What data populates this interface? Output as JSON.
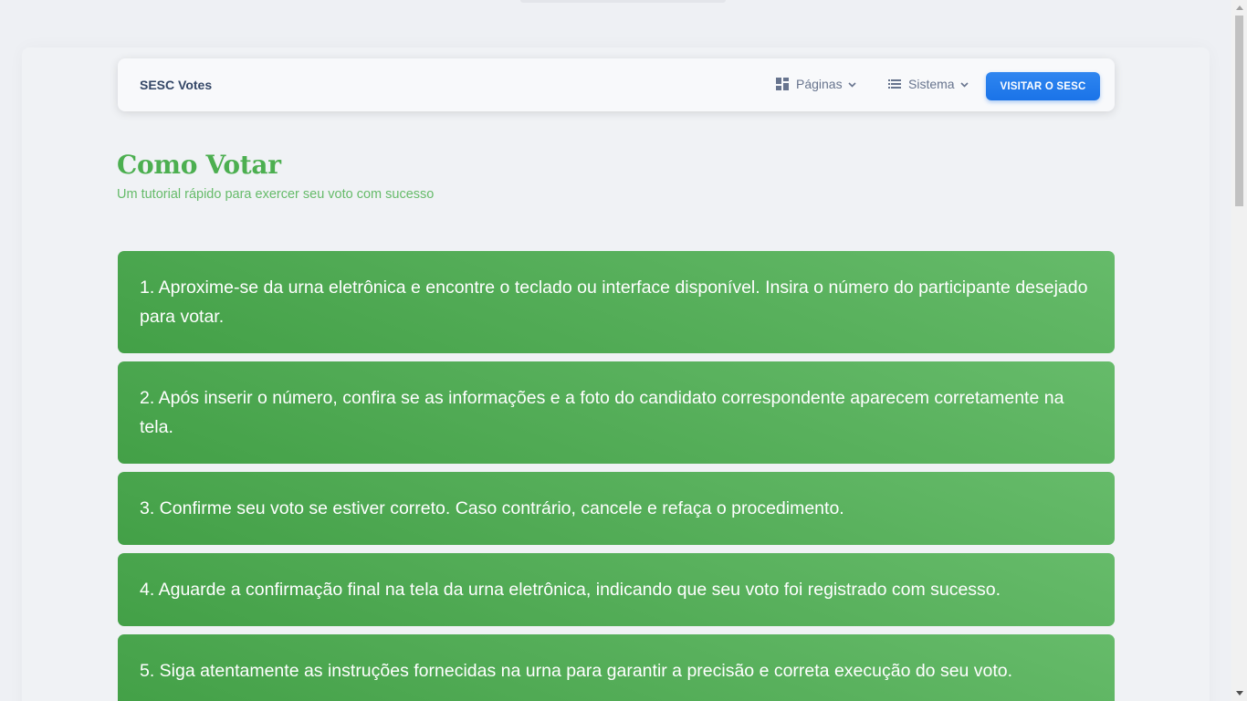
{
  "navbar": {
    "brand": "SESC Votes",
    "pages_label": "Páginas",
    "system_label": "Sistema",
    "visit_button": "VISITAR O SESC"
  },
  "header": {
    "title": "Como Votar",
    "subtitle": "Um tutorial rápido para exercer seu voto com sucesso"
  },
  "steps": [
    "1. Aproxime-se da urna eletrônica e encontre o teclado ou interface disponível. Insira o número do participante desejado para votar.",
    "2. Após inserir o número, confira se as informações e a foto do candidato correspondente aparecem corretamente na tela.",
    "3. Confirme seu voto se estiver correto. Caso contrário, cancele e refaça o procedimento.",
    "4. Aguarde a confirmação final na tela da urna eletrônica, indicando que seu voto foi registrado com sucesso.",
    "5. Siga atentamente as instruções fornecidas na urna para garantir a precisão e correta execução do seu voto."
  ],
  "icons": {
    "pages": "dashboard-icon",
    "system": "list-icon",
    "dropdown": "chevron-down-icon"
  },
  "colors": {
    "accent_green": "#4caf50",
    "step_gradient_start": "#66bb6a",
    "step_gradient_end": "#43a047",
    "button_blue": "#1a73e8",
    "brand_text": "#344767"
  }
}
